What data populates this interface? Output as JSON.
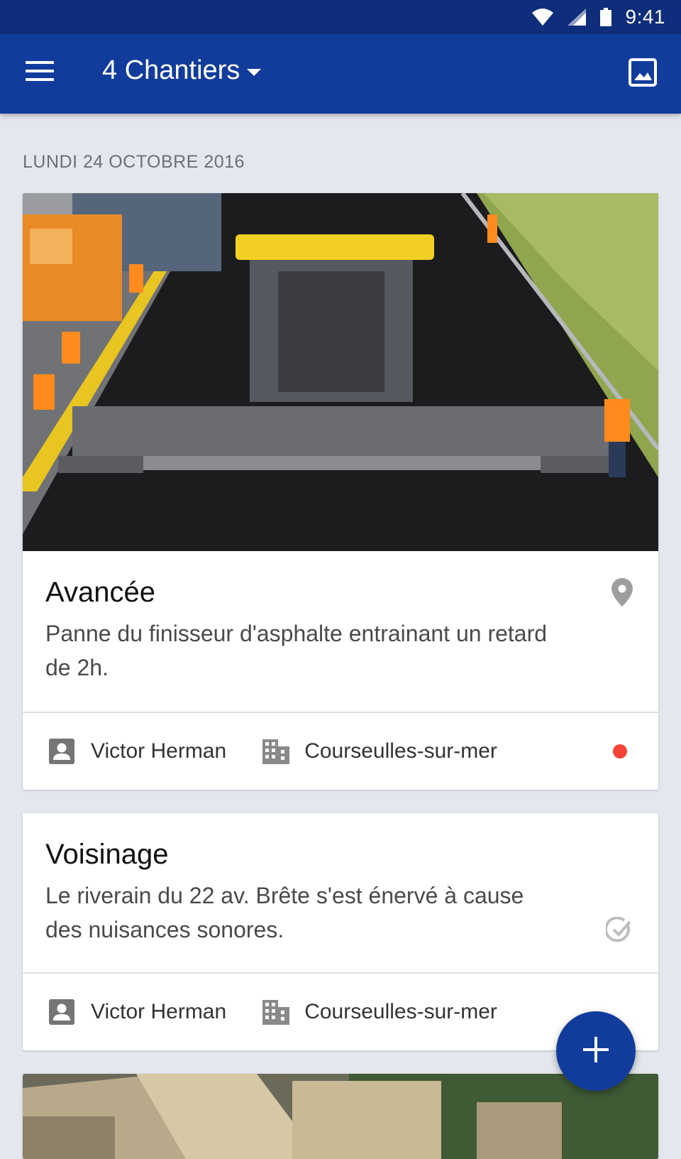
{
  "status_bar": {
    "time": "9:41",
    "icons": [
      "wifi-icon",
      "signal-icon",
      "battery-icon"
    ]
  },
  "app_bar": {
    "title": "4 Chantiers",
    "menu_icon": "menu-icon",
    "action_icon": "image-icon"
  },
  "date_header": "LUNDI 24 OCTOBRE 2016",
  "cards": [
    {
      "title": "Avancée",
      "text": "Panne du finisseur d'asphalte entrainant un retard de 2h.",
      "status_icon": "location-pin-icon",
      "author": "Victor Herman",
      "site": "Courseulles-sur-mer",
      "unread": true
    },
    {
      "title": "Voisinage",
      "text": "Le riverain du 22 av. Brête s'est énervé à cause des nuisances sonores.",
      "status_icon": "check-circle-icon",
      "author": "Victor Herman",
      "site": "Courseulles-sur-mer"
    }
  ],
  "colors": {
    "primary": "#123c9c",
    "status_bar": "#0e2d7a",
    "background": "#e4e7ee",
    "unread_dot": "#f44336"
  },
  "fab": {
    "icon": "plus-icon"
  }
}
